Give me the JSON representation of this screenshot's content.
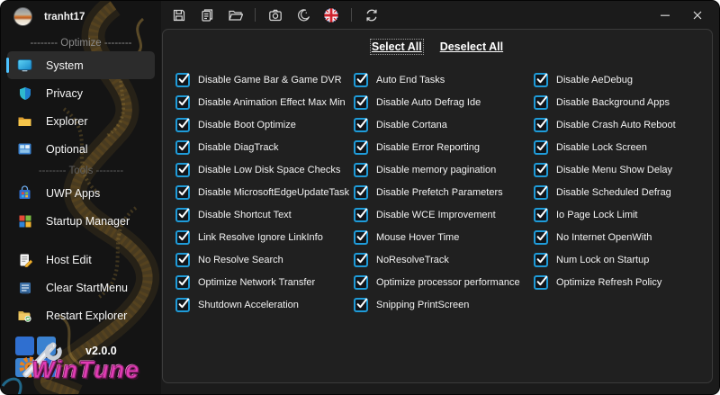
{
  "window": {
    "user": "tranht17",
    "controls": [
      "minimize",
      "close"
    ]
  },
  "toolbar": {
    "icons": [
      "save-icon",
      "copy-icon",
      "open-folder-icon",
      "screenshot-icon",
      "theme-icon",
      "english-language-flag-icon",
      "refresh-icon"
    ]
  },
  "sidebar": {
    "user": "tranht17",
    "optimize": {
      "label": "-------- Optimize --------",
      "items": [
        {
          "label": "System",
          "icon": "display-icon",
          "selected": true
        },
        {
          "label": "Privacy",
          "icon": "shield-icon",
          "selected": false
        },
        {
          "label": "Explorer",
          "icon": "folder-icon",
          "selected": false
        },
        {
          "label": "Optional",
          "icon": "photos-icon",
          "selected": false
        }
      ]
    },
    "tools": {
      "label": "-------- Tools --------",
      "items": [
        {
          "label": "UWP Apps",
          "icon": "store-bag-icon"
        },
        {
          "label": "Startup Manager",
          "icon": "colored-tiles-icon"
        },
        {
          "label": "Host Edit",
          "icon": "edit-document-icon"
        },
        {
          "label": "Clear StartMenu",
          "icon": "list-icon"
        },
        {
          "label": "Restart Explorer",
          "icon": "folder-refresh-icon"
        }
      ]
    },
    "selected_item": "System",
    "version": "v2.0.0",
    "brand": "WinTune"
  },
  "main": {
    "select_all": "Select All",
    "deselect_all": "Deselect All",
    "all_checked": true,
    "columns": [
      [
        "Disable Game Bar & Game DVR",
        "Disable Animation Effect Max Min",
        "Disable Boot Optimize",
        "Disable DiagTrack",
        "Disable Low Disk Space Checks",
        "Disable MicrosoftEdgeUpdateTask",
        "Disable Shortcut Text",
        "Link Resolve Ignore LinkInfo",
        "No Resolve Search",
        "Optimize Network Transfer",
        "Shutdown Acceleration"
      ],
      [
        "Auto End Tasks",
        "Disable Auto Defrag Ide",
        "Disable Cortana",
        "Disable Error Reporting",
        "Disable memory pagination",
        "Disable Prefetch Parameters",
        "Disable WCE Improvement",
        "Mouse Hover Time",
        "NoResolveTrack",
        "Optimize processor performance",
        "Snipping PrintScreen"
      ],
      [
        "Disable AeDebug",
        "Disable Background Apps",
        "Disable Crash Auto Reboot",
        "Disable Lock Screen",
        "Disable Menu Show Delay",
        "Disable Scheduled Defrag",
        "Io Page Lock Limit",
        "No Internet OpenWith",
        "Num Lock on Startup",
        "Optimize Refresh Policy"
      ]
    ]
  },
  "colors": {
    "accent": "#4cc2ff",
    "checkbox_blue": "#1f9bd8",
    "brand_pink": "#e23cb4",
    "panel_bg": "#202020",
    "sidebar_bg": "#141414",
    "window_bg": "#1b1b1b",
    "dragon_gold": "#8a6a2c"
  }
}
